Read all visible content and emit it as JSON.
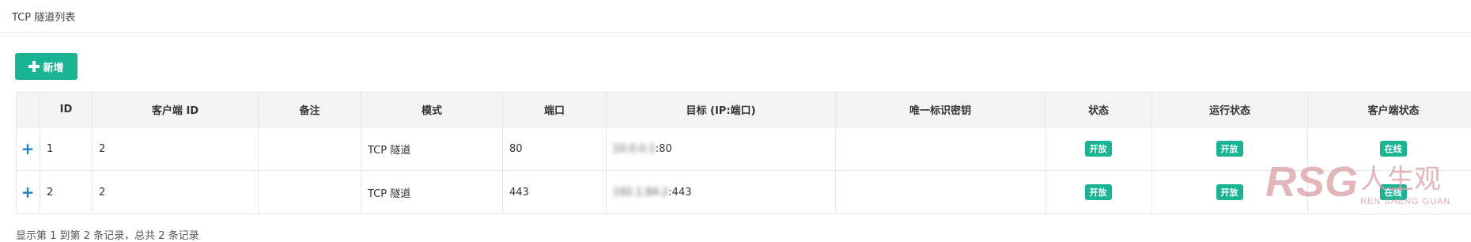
{
  "panel": {
    "title": "TCP 隧道列表"
  },
  "toolbar": {
    "add_label": "新增"
  },
  "table": {
    "headers": [
      "ID",
      "客户端 ID",
      "备注",
      "模式",
      "端口",
      "目标 (IP:端口)",
      "唯一标识密钥",
      "状态",
      "运行状态",
      "客户端状态"
    ],
    "rows": [
      {
        "id": "1",
        "client_id": "2",
        "remark": "",
        "mode": "TCP 隧道",
        "port": "80",
        "target_masked": "10.0.0.1",
        "target_tail": ":80",
        "secret": "",
        "status": "开放",
        "run_status": "开放",
        "client_status": "在线"
      },
      {
        "id": "2",
        "client_id": "2",
        "remark": "",
        "mode": "TCP 隧道",
        "port": "443",
        "target_masked": "192.1.84.2",
        "target_tail": ":443",
        "secret": "",
        "status": "开放",
        "run_status": "开放",
        "client_status": "在线"
      }
    ]
  },
  "footer": {
    "summary": "显示第 1 到第 2 条记录，总共 2 条记录"
  },
  "watermark": {
    "logo": "RSG",
    "cn": "人生观",
    "en": "REN SHENG GUAN"
  },
  "colors": {
    "primary": "#1ab394",
    "expand": "#1c84c6",
    "watermark": "#d9a0a4"
  }
}
